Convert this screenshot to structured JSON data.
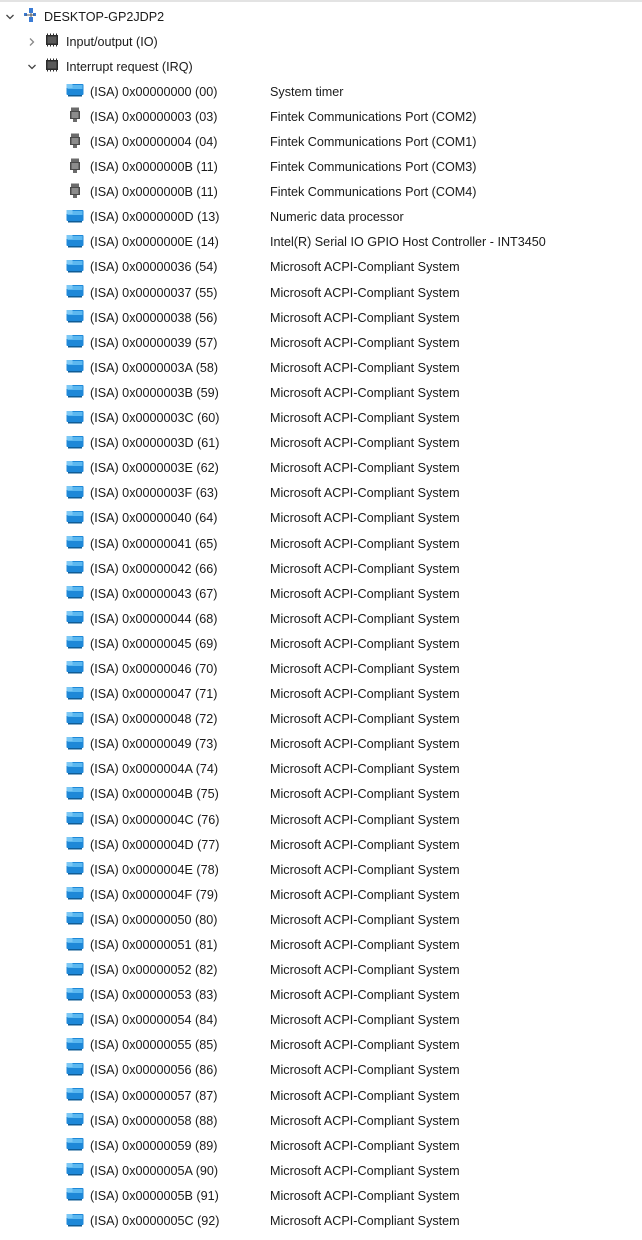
{
  "root": {
    "label": "DESKTOP-GP2JDP2",
    "expanded": true,
    "icon": "computer-icon"
  },
  "categories": [
    {
      "label": "Input/output (IO)",
      "expanded": false,
      "icon": "chip-icon"
    },
    {
      "label": "Interrupt request (IRQ)",
      "expanded": true,
      "icon": "chip-icon"
    }
  ],
  "irq_rows": [
    {
      "addr": "(ISA) 0x00000000 (00)",
      "desc": "System timer",
      "icon": "system-device-icon"
    },
    {
      "addr": "(ISA) 0x00000003 (03)",
      "desc": "Fintek Communications Port (COM2)",
      "icon": "port-icon"
    },
    {
      "addr": "(ISA) 0x00000004 (04)",
      "desc": "Fintek Communications Port (COM1)",
      "icon": "port-icon"
    },
    {
      "addr": "(ISA) 0x0000000B (11)",
      "desc": "Fintek Communications Port (COM3)",
      "icon": "port-icon"
    },
    {
      "addr": "(ISA) 0x0000000B (11)",
      "desc": "Fintek Communications Port (COM4)",
      "icon": "port-icon"
    },
    {
      "addr": "(ISA) 0x0000000D (13)",
      "desc": "Numeric data processor",
      "icon": "system-device-icon"
    },
    {
      "addr": "(ISA) 0x0000000E (14)",
      "desc": "Intel(R) Serial IO GPIO Host Controller - INT3450",
      "icon": "system-device-icon"
    },
    {
      "addr": "(ISA) 0x00000036 (54)",
      "desc": "Microsoft ACPI-Compliant System",
      "icon": "system-device-icon"
    },
    {
      "addr": "(ISA) 0x00000037 (55)",
      "desc": "Microsoft ACPI-Compliant System",
      "icon": "system-device-icon"
    },
    {
      "addr": "(ISA) 0x00000038 (56)",
      "desc": "Microsoft ACPI-Compliant System",
      "icon": "system-device-icon"
    },
    {
      "addr": "(ISA) 0x00000039 (57)",
      "desc": "Microsoft ACPI-Compliant System",
      "icon": "system-device-icon"
    },
    {
      "addr": "(ISA) 0x0000003A (58)",
      "desc": "Microsoft ACPI-Compliant System",
      "icon": "system-device-icon"
    },
    {
      "addr": "(ISA) 0x0000003B (59)",
      "desc": "Microsoft ACPI-Compliant System",
      "icon": "system-device-icon"
    },
    {
      "addr": "(ISA) 0x0000003C (60)",
      "desc": "Microsoft ACPI-Compliant System",
      "icon": "system-device-icon"
    },
    {
      "addr": "(ISA) 0x0000003D (61)",
      "desc": "Microsoft ACPI-Compliant System",
      "icon": "system-device-icon"
    },
    {
      "addr": "(ISA) 0x0000003E (62)",
      "desc": "Microsoft ACPI-Compliant System",
      "icon": "system-device-icon"
    },
    {
      "addr": "(ISA) 0x0000003F (63)",
      "desc": "Microsoft ACPI-Compliant System",
      "icon": "system-device-icon"
    },
    {
      "addr": "(ISA) 0x00000040 (64)",
      "desc": "Microsoft ACPI-Compliant System",
      "icon": "system-device-icon"
    },
    {
      "addr": "(ISA) 0x00000041 (65)",
      "desc": "Microsoft ACPI-Compliant System",
      "icon": "system-device-icon"
    },
    {
      "addr": "(ISA) 0x00000042 (66)",
      "desc": "Microsoft ACPI-Compliant System",
      "icon": "system-device-icon"
    },
    {
      "addr": "(ISA) 0x00000043 (67)",
      "desc": "Microsoft ACPI-Compliant System",
      "icon": "system-device-icon"
    },
    {
      "addr": "(ISA) 0x00000044 (68)",
      "desc": "Microsoft ACPI-Compliant System",
      "icon": "system-device-icon"
    },
    {
      "addr": "(ISA) 0x00000045 (69)",
      "desc": "Microsoft ACPI-Compliant System",
      "icon": "system-device-icon"
    },
    {
      "addr": "(ISA) 0x00000046 (70)",
      "desc": "Microsoft ACPI-Compliant System",
      "icon": "system-device-icon"
    },
    {
      "addr": "(ISA) 0x00000047 (71)",
      "desc": "Microsoft ACPI-Compliant System",
      "icon": "system-device-icon"
    },
    {
      "addr": "(ISA) 0x00000048 (72)",
      "desc": "Microsoft ACPI-Compliant System",
      "icon": "system-device-icon"
    },
    {
      "addr": "(ISA) 0x00000049 (73)",
      "desc": "Microsoft ACPI-Compliant System",
      "icon": "system-device-icon"
    },
    {
      "addr": "(ISA) 0x0000004A (74)",
      "desc": "Microsoft ACPI-Compliant System",
      "icon": "system-device-icon"
    },
    {
      "addr": "(ISA) 0x0000004B (75)",
      "desc": "Microsoft ACPI-Compliant System",
      "icon": "system-device-icon"
    },
    {
      "addr": "(ISA) 0x0000004C (76)",
      "desc": "Microsoft ACPI-Compliant System",
      "icon": "system-device-icon"
    },
    {
      "addr": "(ISA) 0x0000004D (77)",
      "desc": "Microsoft ACPI-Compliant System",
      "icon": "system-device-icon"
    },
    {
      "addr": "(ISA) 0x0000004E (78)",
      "desc": "Microsoft ACPI-Compliant System",
      "icon": "system-device-icon"
    },
    {
      "addr": "(ISA) 0x0000004F (79)",
      "desc": "Microsoft ACPI-Compliant System",
      "icon": "system-device-icon"
    },
    {
      "addr": "(ISA) 0x00000050 (80)",
      "desc": "Microsoft ACPI-Compliant System",
      "icon": "system-device-icon"
    },
    {
      "addr": "(ISA) 0x00000051 (81)",
      "desc": "Microsoft ACPI-Compliant System",
      "icon": "system-device-icon"
    },
    {
      "addr": "(ISA) 0x00000052 (82)",
      "desc": "Microsoft ACPI-Compliant System",
      "icon": "system-device-icon"
    },
    {
      "addr": "(ISA) 0x00000053 (83)",
      "desc": "Microsoft ACPI-Compliant System",
      "icon": "system-device-icon"
    },
    {
      "addr": "(ISA) 0x00000054 (84)",
      "desc": "Microsoft ACPI-Compliant System",
      "icon": "system-device-icon"
    },
    {
      "addr": "(ISA) 0x00000055 (85)",
      "desc": "Microsoft ACPI-Compliant System",
      "icon": "system-device-icon"
    },
    {
      "addr": "(ISA) 0x00000056 (86)",
      "desc": "Microsoft ACPI-Compliant System",
      "icon": "system-device-icon"
    },
    {
      "addr": "(ISA) 0x00000057 (87)",
      "desc": "Microsoft ACPI-Compliant System",
      "icon": "system-device-icon"
    },
    {
      "addr": "(ISA) 0x00000058 (88)",
      "desc": "Microsoft ACPI-Compliant System",
      "icon": "system-device-icon"
    },
    {
      "addr": "(ISA) 0x00000059 (89)",
      "desc": "Microsoft ACPI-Compliant System",
      "icon": "system-device-icon"
    },
    {
      "addr": "(ISA) 0x0000005A (90)",
      "desc": "Microsoft ACPI-Compliant System",
      "icon": "system-device-icon"
    },
    {
      "addr": "(ISA) 0x0000005B (91)",
      "desc": "Microsoft ACPI-Compliant System",
      "icon": "system-device-icon"
    },
    {
      "addr": "(ISA) 0x0000005C (92)",
      "desc": "Microsoft ACPI-Compliant System",
      "icon": "system-device-icon"
    }
  ]
}
